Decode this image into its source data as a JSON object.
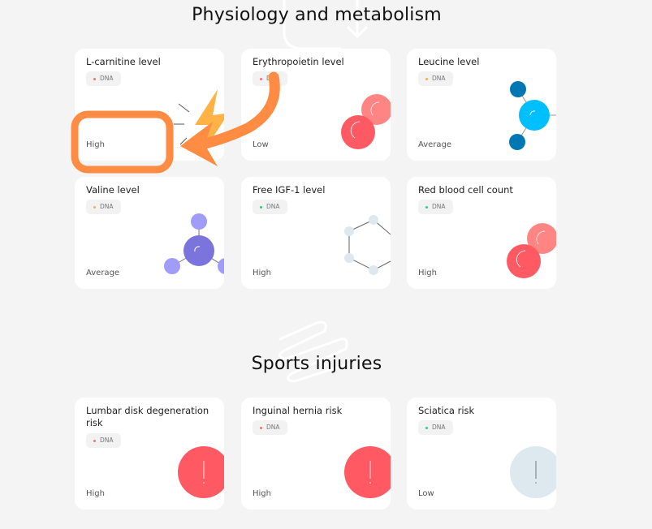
{
  "sections": [
    {
      "title": "Physiology and metabolism",
      "cards": [
        {
          "title": "L-carnitine level",
          "badge": "DNA",
          "badge_dot_color": "#ff6b6b",
          "level": "High",
          "illustration": "lightning-icon"
        },
        {
          "title": "Erythropoietin level",
          "badge": "DNA",
          "badge_dot_color": "#ff6b6b",
          "level": "Low",
          "illustration": "red-blood-cells-icon"
        },
        {
          "title": "Leucine level",
          "badge": "DNA",
          "badge_dot_color": "#ffa94d",
          "level": "Average",
          "illustration": "molecule-blue-icon"
        },
        {
          "title": "Valine level",
          "badge": "DNA",
          "badge_dot_color": "#ffa94d",
          "level": "Average",
          "illustration": "molecule-purple-icon"
        },
        {
          "title": "Free IGF-1 level",
          "badge": "DNA",
          "badge_dot_color": "#2ecc71",
          "level": "High",
          "illustration": "hexagon-molecule-icon"
        },
        {
          "title": "Red blood cell count",
          "badge": "DNA",
          "badge_dot_color": "#2ecc9a",
          "level": "High",
          "illustration": "red-blood-cells-icon"
        }
      ]
    },
    {
      "title": "Sports injuries",
      "cards": [
        {
          "title": "Lumbar disk degeneration risk",
          "badge": "DNA",
          "badge_dot_color": "#ff6b6b",
          "level": "High",
          "illustration": "warning-circle-red-icon"
        },
        {
          "title": "Inguinal hernia risk",
          "badge": "DNA",
          "badge_dot_color": "#ff6b6b",
          "level": "High",
          "illustration": "warning-circle-red-icon"
        },
        {
          "title": "Sciatica risk",
          "badge": "DNA",
          "badge_dot_color": "#2ecc9a",
          "level": "Low",
          "illustration": "warning-circle-grey-icon"
        }
      ]
    }
  ],
  "colors": {
    "annotation_orange": "#ff8c42",
    "red_cell": "#ff5a64",
    "red_cell_light": "#ff8585",
    "blue_atom": "#00bfff",
    "blue_atom_dark": "#0077b3",
    "purple_atom": "#7b74dd",
    "purple_atom_light": "#a19cf8",
    "hex_node": "#dde9ee",
    "grey_circle": "#dde9ee"
  }
}
